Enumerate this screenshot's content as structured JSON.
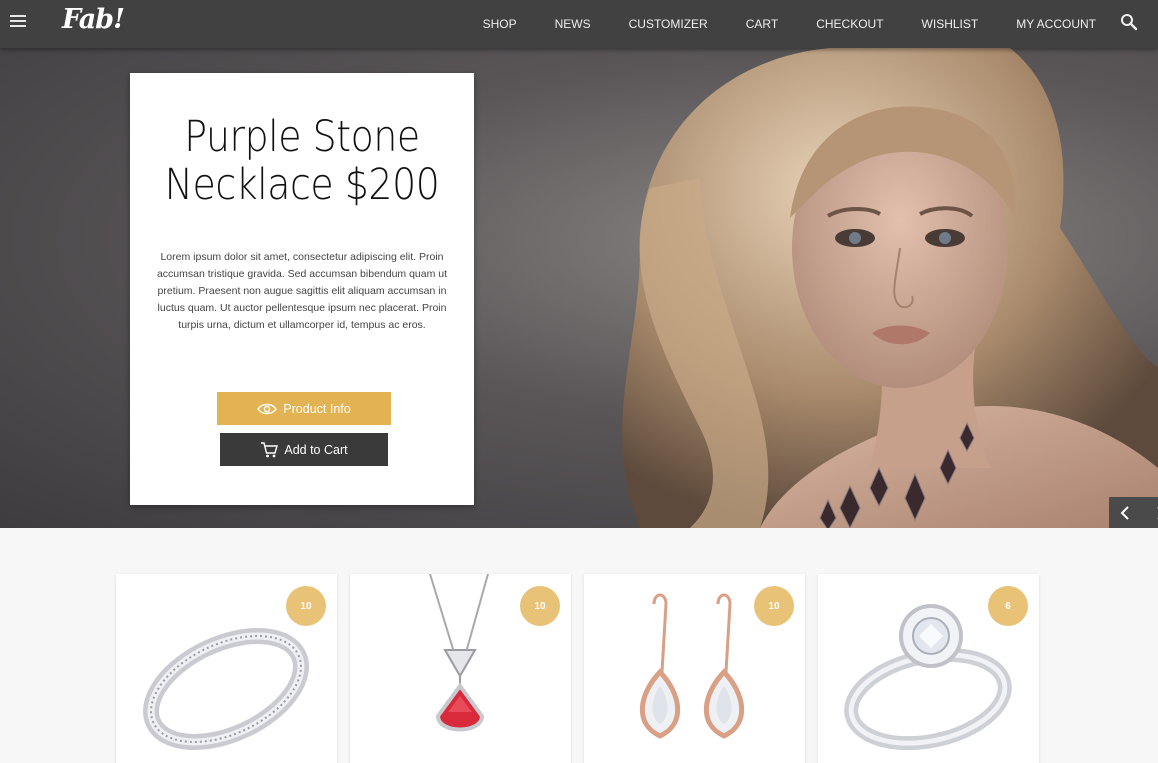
{
  "header": {
    "logo": "Fab!",
    "nav": [
      "SHOP",
      "NEWS",
      "CUSTOMIZER",
      "CART",
      "CHECKOUT",
      "WISHLIST",
      "MY ACCOUNT"
    ]
  },
  "hero": {
    "title_line1": "Purple Stone",
    "title_line2": "Necklace $200",
    "description": "Lorem ipsum dolor sit amet, consectetur adipiscing elit. Proin accumsan tristique gravida. Sed accumsan bibendum quam ut pretium. Praesent non augue sagittis elit aliquam accumsan in luctus quam. Ut auctor pellentesque ipsum nec placerat. Proin turpis urna, dictum et ullamcorper id, tempus ac eros.",
    "product_info_label": "Product Info",
    "add_to_cart_label": "Add to Cart"
  },
  "products": [
    {
      "badge": "10",
      "type": "band ring"
    },
    {
      "badge": "10",
      "type": "ruby pendant necklace"
    },
    {
      "badge": "10",
      "type": "rose gold drop earrings"
    },
    {
      "badge": "6",
      "type": "diamond engagement ring"
    }
  ],
  "colors": {
    "topbar": "#414141",
    "accent_gold": "#e3b253",
    "badge_gold": "#e7c277",
    "dark_button": "#3b3a3a"
  },
  "icons": [
    "menu-icon",
    "search-icon",
    "eye-icon",
    "cart-icon",
    "chevron-left-icon",
    "chevron-right-icon"
  ]
}
